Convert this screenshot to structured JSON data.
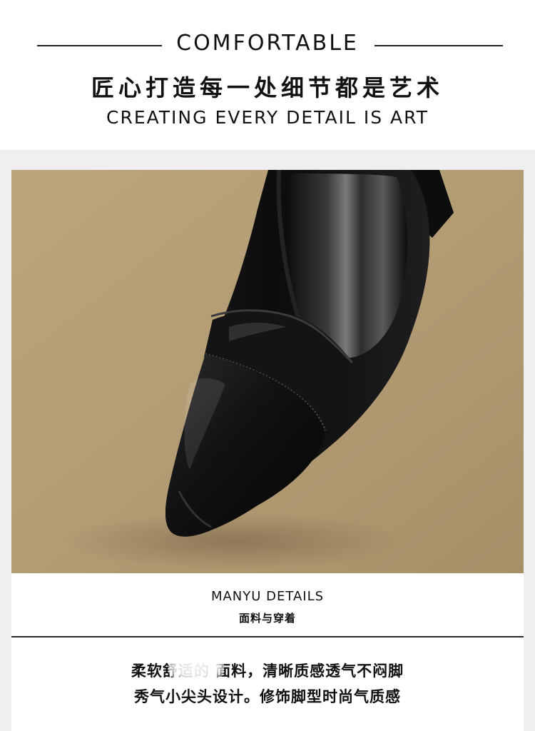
{
  "header": {
    "title_en": "COMFORTABLE",
    "title_cn": "匠心打造每一处细节都是艺术",
    "subtitle_en": "CREATING EVERY DETAIL IS ART"
  },
  "photo": {
    "subject": "black pointed-toe leather pump",
    "background_color": "#b39d76",
    "shoe_color": "#0f0f10"
  },
  "details": {
    "title": "MANYU DETAILS",
    "subtitle": "面料与穿着",
    "body_line_1": "柔软舒适的      面料，清晰质感透气不闷脚",
    "body_line_2": "秀气小尖头设计。修饰脚型时尚气质感"
  },
  "colors": {
    "page_bg": "#ffffff",
    "band_bg": "#efefef",
    "rule": "#222222"
  }
}
